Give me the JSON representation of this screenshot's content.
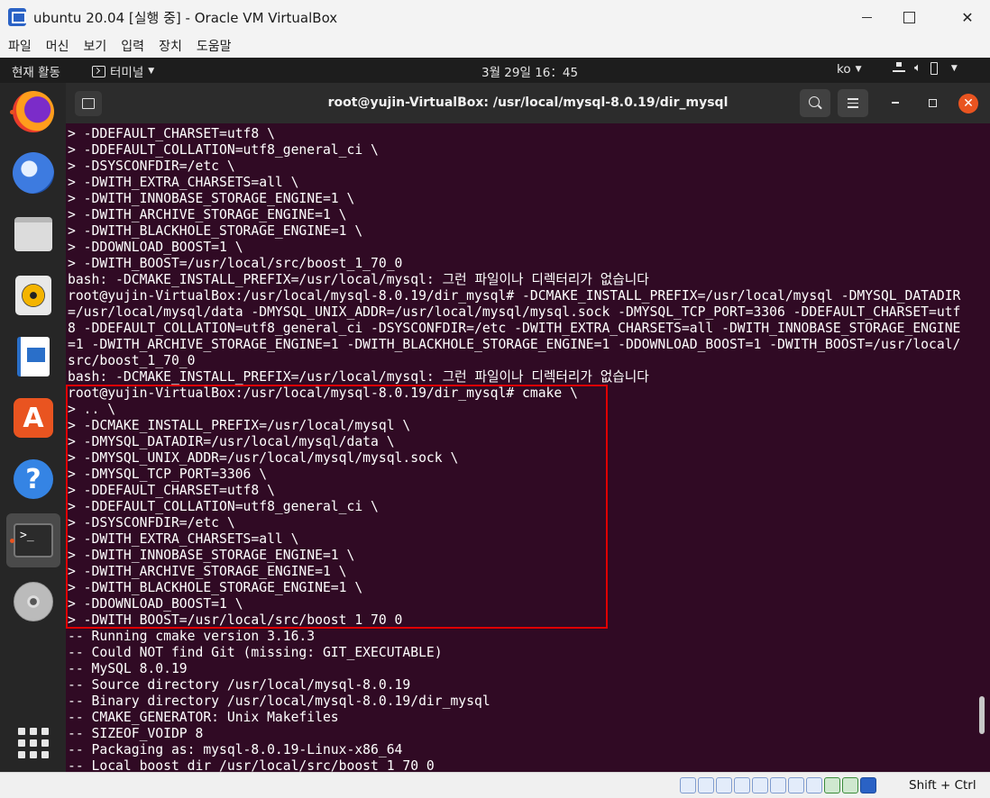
{
  "window": {
    "title": "ubuntu 20.04 [실행 중] - Oracle VM VirtualBox",
    "menu": [
      "파일",
      "머신",
      "보기",
      "입력",
      "장치",
      "도움말"
    ]
  },
  "panel": {
    "activities": "현재 활동",
    "app_name": "터미널",
    "clock": "3월 29일  16：45",
    "language": "ko"
  },
  "dock": {
    "items": [
      {
        "name": "firefox-icon",
        "running": true
      },
      {
        "name": "thunderbird-icon",
        "running": false
      },
      {
        "name": "files-icon",
        "running": false
      },
      {
        "name": "rhythmbox-icon",
        "running": false
      },
      {
        "name": "libreoffice-writer-icon",
        "running": false
      },
      {
        "name": "ubuntu-software-icon",
        "running": false
      },
      {
        "name": "help-icon",
        "running": false
      },
      {
        "name": "terminal-icon",
        "running": true,
        "active": true
      },
      {
        "name": "dvd-icon",
        "running": false
      },
      {
        "name": "show-applications-icon",
        "running": false
      }
    ]
  },
  "terminal": {
    "title": "root@yujin-VirtualBox: /usr/local/mysql-8.0.19/dir_mysql",
    "lines": [
      "> -DDEFAULT_CHARSET=utf8 \\",
      "> -DDEFAULT_COLLATION=utf8_general_ci \\",
      "> -DSYSCONFDIR=/etc \\",
      "> -DWITH_EXTRA_CHARSETS=all \\",
      "> -DWITH_INNOBASE_STORAGE_ENGINE=1 \\",
      "> -DWITH_ARCHIVE_STORAGE_ENGINE=1 \\",
      "> -DWITH_BLACKHOLE_STORAGE_ENGINE=1 \\",
      "> -DDOWNLOAD_BOOST=1 \\",
      "> -DWITH_BOOST=/usr/local/src/boost_1_70_0",
      "bash: -DCMAKE_INSTALL_PREFIX=/usr/local/mysql: 그런 파일이나 디렉터리가 없습니다",
      "root@yujin-VirtualBox:/usr/local/mysql-8.0.19/dir_mysql# -DCMAKE_INSTALL_PREFIX=/usr/local/mysql -DMYSQL_DATADIR",
      "=/usr/local/mysql/data -DMYSQL_UNIX_ADDR=/usr/local/mysql/mysql.sock -DMYSQL_TCP_PORT=3306 -DDEFAULT_CHARSET=utf",
      "8 -DDEFAULT_COLLATION=utf8_general_ci -DSYSCONFDIR=/etc -DWITH_EXTRA_CHARSETS=all -DWITH_INNOBASE_STORAGE_ENGINE",
      "=1 -DWITH_ARCHIVE_STORAGE_ENGINE=1 -DWITH_BLACKHOLE_STORAGE_ENGINE=1 -DDOWNLOAD_BOOST=1 -DWITH_BOOST=/usr/local/",
      "src/boost_1_70_0",
      "bash: -DCMAKE_INSTALL_PREFIX=/usr/local/mysql: 그런 파일이나 디렉터리가 없습니다",
      "root@yujin-VirtualBox:/usr/local/mysql-8.0.19/dir_mysql# cmake \\",
      "> .. \\",
      "> -DCMAKE_INSTALL_PREFIX=/usr/local/mysql \\",
      "> -DMYSQL_DATADIR=/usr/local/mysql/data \\",
      "> -DMYSQL_UNIX_ADDR=/usr/local/mysql/mysql.sock \\",
      "> -DMYSQL_TCP_PORT=3306 \\",
      "> -DDEFAULT_CHARSET=utf8 \\",
      "> -DDEFAULT_COLLATION=utf8_general_ci \\",
      "> -DSYSCONFDIR=/etc \\",
      "> -DWITH_EXTRA_CHARSETS=all \\",
      "> -DWITH_INNOBASE_STORAGE_ENGINE=1 \\",
      "> -DWITH_ARCHIVE_STORAGE_ENGINE=1 \\",
      "> -DWITH_BLACKHOLE_STORAGE_ENGINE=1 \\",
      "> -DDOWNLOAD_BOOST=1 \\",
      "> -DWITH_BOOST=/usr/local/src/boost_1_70_0",
      "-- Running cmake version 3.16.3",
      "-- Could NOT find Git (missing: GIT_EXECUTABLE)",
      "-- MySQL 8.0.19",
      "-- Source directory /usr/local/mysql-8.0.19",
      "-- Binary directory /usr/local/mysql-8.0.19/dir_mysql",
      "-- CMAKE_GENERATOR: Unix Makefiles",
      "-- SIZEOF_VOIDP 8",
      "-- Packaging as: mysql-8.0.19-Linux-x86_64",
      "-- Local boost dir /usr/local/src/boost_1_70_0"
    ]
  },
  "statusbar": {
    "host_key": "Shift + Ctrl"
  },
  "colors": {
    "terminal_bg": "#300a24",
    "highlight_border": "#e00000",
    "ubuntu_orange": "#e95420"
  }
}
